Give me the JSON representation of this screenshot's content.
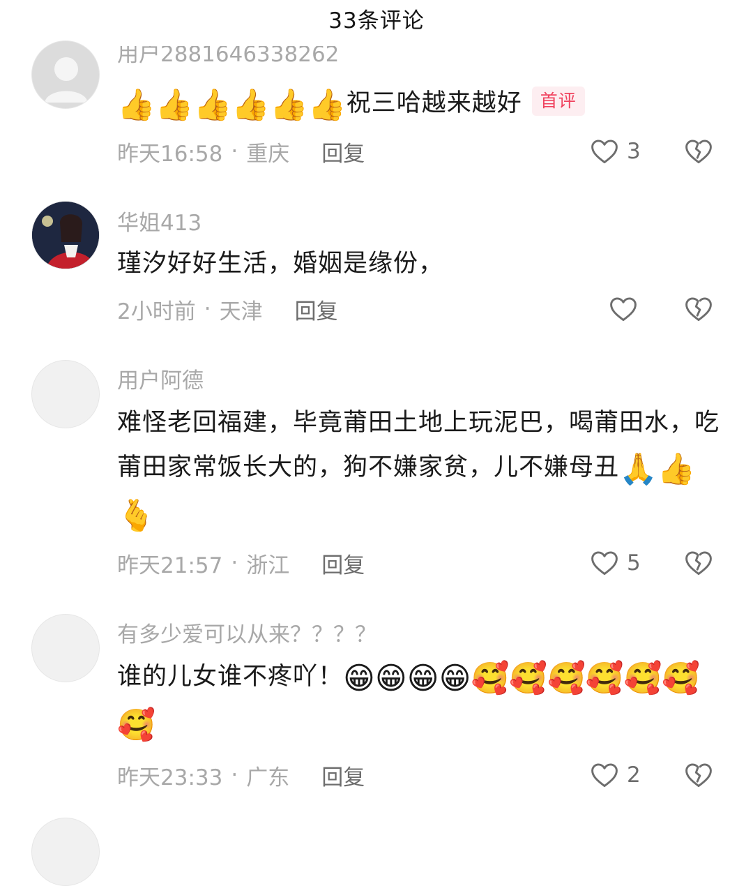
{
  "header": {
    "title": "33条评论"
  },
  "comments": [
    {
      "username": "用户2881646338262",
      "text": "祝三哈越来越好",
      "emojis_before": "👍👍👍👍👍👍",
      "emojis_after": "",
      "badge": "首评",
      "time": "昨天16:58",
      "location": "重庆",
      "reply_label": "回复",
      "likes": "3"
    },
    {
      "username": "华姐413",
      "text": "瑾汐好好生活，婚姻是缘份，",
      "emojis_before": "",
      "emojis_after": "",
      "badge": "",
      "time": "2小时前",
      "location": "天津",
      "reply_label": "回复",
      "likes": ""
    },
    {
      "username": "用户阿德",
      "text": "难怪老回福建，毕竟莆田土地上玩泥巴，喝莆田水，吃莆田家常饭长大的，狗不嫌家贫，儿不嫌母丑",
      "emojis_before": "",
      "emojis_after": "🙏👍🫰",
      "badge": "",
      "time": "昨天21:57",
      "location": "浙江",
      "reply_label": "回复",
      "likes": "5"
    },
    {
      "username": "有多少爱可以从来？？？？",
      "text": "谁的儿女谁不疼吖！",
      "emojis_before": "",
      "emojis_after": "😁😁😁😁🥰🥰🥰🥰🥰🥰🥰",
      "badge": "",
      "time": "昨天23:33",
      "location": "广东",
      "reply_label": "回复",
      "likes": "2"
    }
  ],
  "icons": {
    "like": "heart-outline-icon",
    "dislike": "broken-heart-icon",
    "avatar_default": "default-user-avatar-icon"
  },
  "colors": {
    "badge_text": "#f0425e",
    "badge_bg": "#fdeef1",
    "meta_text": "#a8a8a8",
    "reply_text": "#6d6d6d"
  }
}
